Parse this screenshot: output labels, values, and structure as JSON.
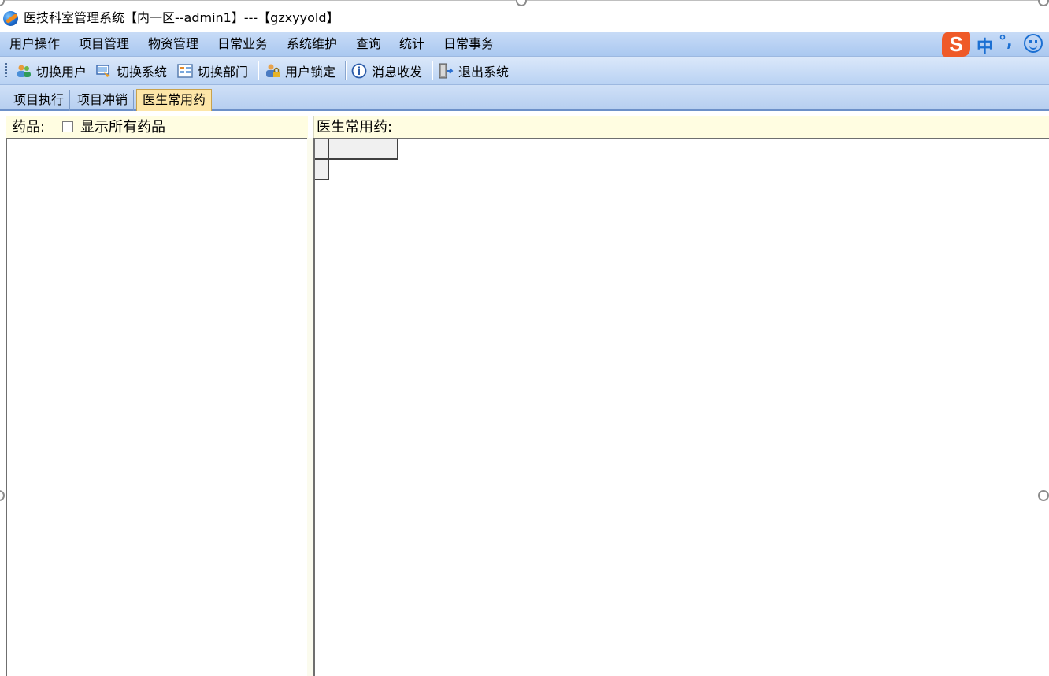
{
  "window": {
    "title": "医技科室管理系统【内一区--admin1】---【gzxyyold】"
  },
  "menubar": {
    "items": [
      "用户操作",
      "项目管理",
      "物资管理",
      "日常业务",
      "系统维护",
      "查询",
      "统计",
      "日常事务"
    ]
  },
  "ime": {
    "logo": "S",
    "mode": "中",
    "punct": "°,"
  },
  "toolbar": {
    "items": [
      {
        "label": "切换用户",
        "icon": "users-switch-icon"
      },
      {
        "label": "切换系统",
        "icon": "system-switch-icon"
      },
      {
        "label": "切换部门",
        "icon": "department-switch-icon"
      },
      {
        "label": "用户锁定",
        "icon": "user-lock-icon"
      },
      {
        "label": "消息收发",
        "icon": "message-icon"
      },
      {
        "label": "退出系统",
        "icon": "exit-icon"
      }
    ]
  },
  "tabs": [
    {
      "label": "项目执行",
      "active": false
    },
    {
      "label": "项目冲销",
      "active": false
    },
    {
      "label": "医生常用药",
      "active": true
    }
  ],
  "left_panel": {
    "label": "药品:",
    "checkbox_label": "显示所有药品",
    "checkbox_checked": false
  },
  "right_panel": {
    "label": "医生常用药:"
  }
}
